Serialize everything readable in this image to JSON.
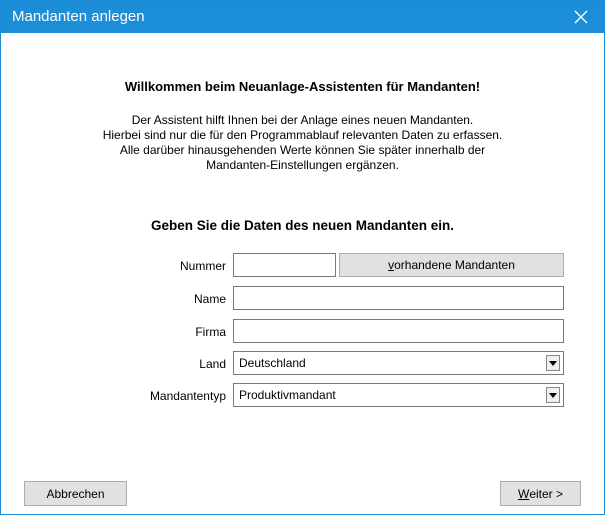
{
  "window": {
    "title": "Mandanten anlegen"
  },
  "welcome": {
    "heading": "Willkommen beim Neuanlage-Assistenten für Mandanten!",
    "lines": [
      "Der Assistent hilft Ihnen bei der Anlage eines neuen Mandanten.",
      "Hierbei sind nur die für den Programmablauf relevanten Daten zu erfassen.",
      "Alle darüber hinausgehenden Werte können Sie später innerhalb der",
      "Mandanten-Einstellungen ergänzen."
    ]
  },
  "form": {
    "heading": "Geben Sie die Daten des neuen Mandanten ein.",
    "nummer": {
      "label": "Nummer",
      "value": ""
    },
    "existing_button": {
      "underlined": "v",
      "rest": "orhandene Mandanten"
    },
    "name": {
      "label": "Name",
      "value": ""
    },
    "firma": {
      "label": "Firma",
      "value": ""
    },
    "land": {
      "label": "Land",
      "value": "Deutschland"
    },
    "mandantentyp": {
      "label": "Mandantentyp",
      "value": "Produktivmandant"
    }
  },
  "buttons": {
    "cancel": "Abbrechen",
    "next_underlined": "W",
    "next_rest": "eiter >"
  },
  "colors": {
    "titlebar": "#1c8ed8",
    "button_bg": "#e1e1e1"
  },
  "icons": {
    "close": "close-icon",
    "dropdown": "chevron-down-icon"
  }
}
